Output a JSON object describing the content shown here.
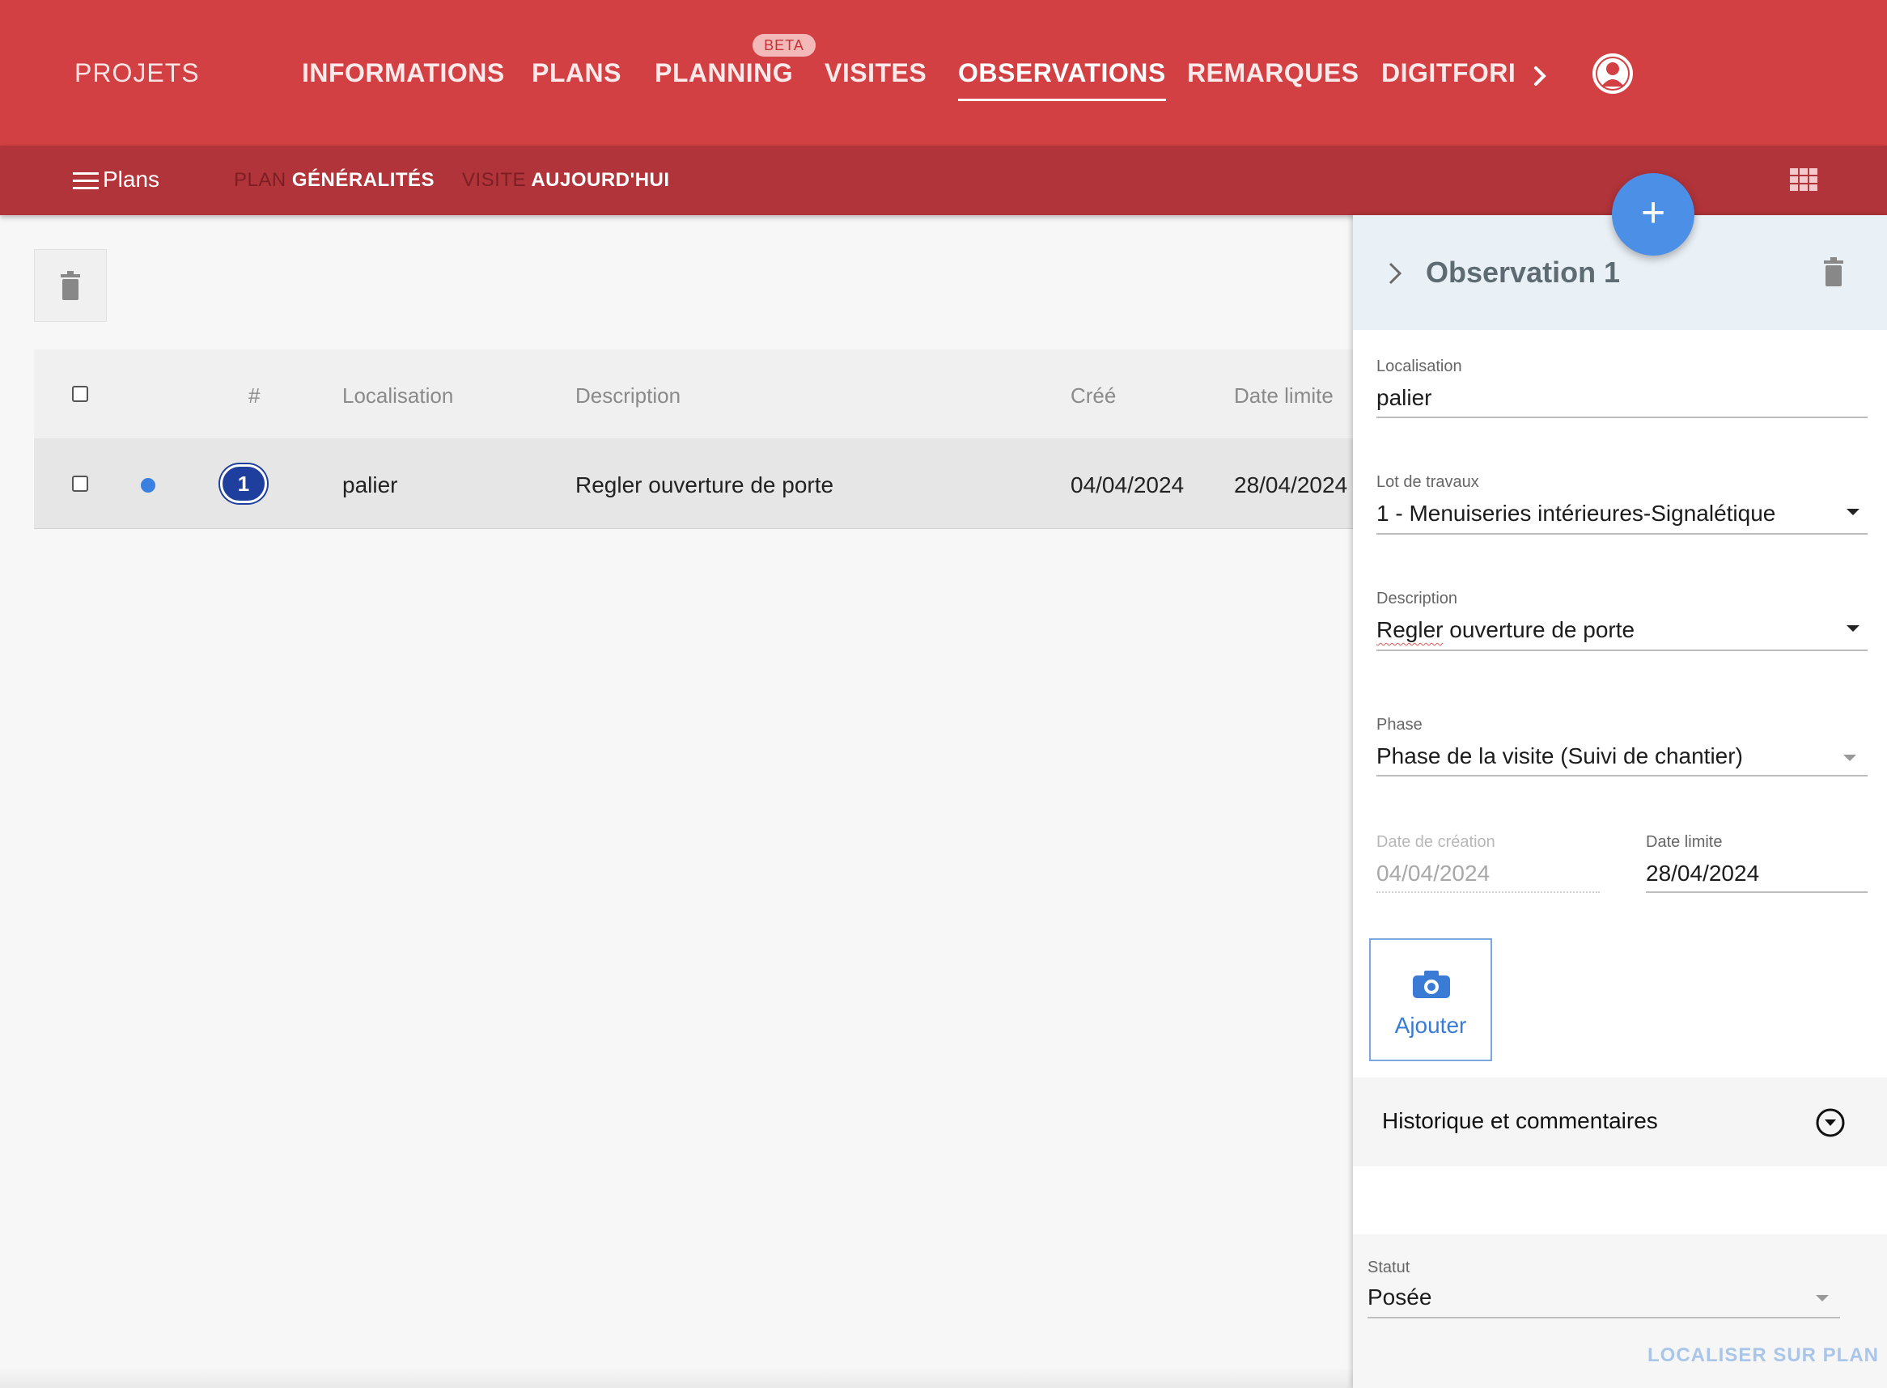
{
  "topbar": {
    "brand": "PROJETS",
    "tabs": [
      {
        "label": "INFORMATIONS"
      },
      {
        "label": "PLANS"
      },
      {
        "label": "PLANNING",
        "badge": "BETA"
      },
      {
        "label": "VISITES"
      },
      {
        "label": "OBSERVATIONS",
        "active": true
      },
      {
        "label": "REMARQUES"
      },
      {
        "label": "DIGITFORI"
      }
    ],
    "more_icon": "chevron-right-icon",
    "avatar_icon": "user-avatar-icon",
    "colors": {
      "primary": "#d24043",
      "secondary": "#b1343a"
    }
  },
  "subbar": {
    "menu_icon": "hamburger-icon",
    "plans_label": "Plans",
    "plan_key": "PLAN",
    "plan_value": "GÉNÉRALITÉS",
    "visite_key": "VISITE",
    "visite_value": "AUJOURD'HUI",
    "grid_icon": "grid-view-icon",
    "fab_label": "+"
  },
  "table": {
    "delete_icon": "trash-icon",
    "headers": {
      "number": "#",
      "localisation": "Localisation",
      "description": "Description",
      "cree": "Créé",
      "date_limite": "Date limite"
    },
    "rows": [
      {
        "number": "1",
        "localisation": "palier",
        "description": "Regler ouverture de porte",
        "cree": "04/04/2024",
        "date_limite": "28/04/2024",
        "status_color": "#3b7fe0"
      }
    ]
  },
  "panel": {
    "title": "Observation 1",
    "fields": {
      "localisation_label": "Localisation",
      "localisation_value": "palier",
      "lot_label": "Lot de travaux",
      "lot_value": "1 - Menuiseries intérieures-Signalétique",
      "description_label": "Description",
      "description_value_word1": "Regler",
      "description_value_rest": " ouverture de porte",
      "phase_label": "Phase",
      "phase_value": "Phase de la visite (Suivi de chantier)",
      "date_creation_label": "Date de création",
      "date_creation_value": "04/04/2024",
      "date_limite_label": "Date limite",
      "date_limite_value": "28/04/2024"
    },
    "add_photo_label": "Ajouter",
    "camera_icon": "camera-icon",
    "history_label": "Historique et commentaires",
    "history_icon": "expand-circle-icon",
    "statut_label": "Statut",
    "statut_value": "Posée",
    "localiser_label": "LOCALISER SUR PLAN"
  }
}
